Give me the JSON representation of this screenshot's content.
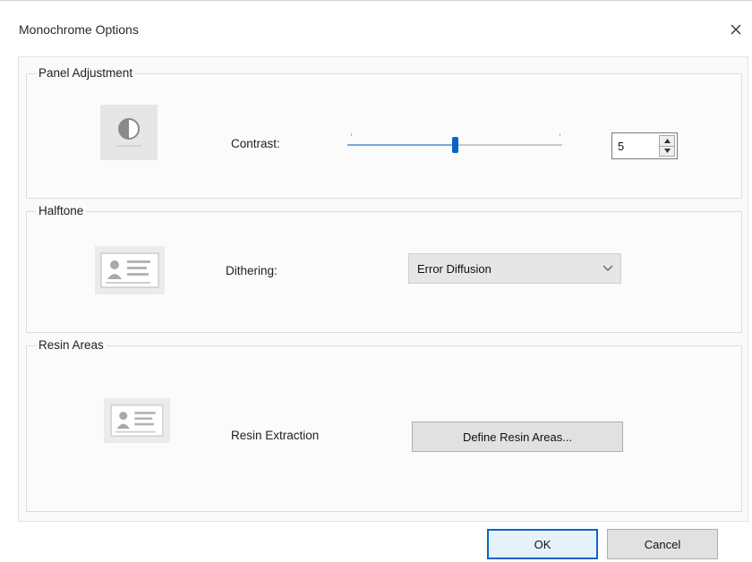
{
  "window": {
    "title": "Monochrome Options",
    "close_glyph": "✕"
  },
  "panel_adjustment": {
    "heading": "Panel Adjustment",
    "icon": "contrast-icon",
    "contrast_label": "Contrast:",
    "contrast_value": "5",
    "slider": {
      "min": 0,
      "max": 10,
      "value": 5
    }
  },
  "halftone": {
    "heading": "Halftone",
    "icon": "id-card-icon",
    "dithering_label": "Dithering:",
    "dithering_selected": "Error Diffusion"
  },
  "resin_areas": {
    "heading": "Resin Areas",
    "icon": "id-card-icon",
    "extraction_label": "Resin Extraction",
    "define_button": "Define Resin Areas..."
  },
  "footer": {
    "ok_label": "OK",
    "cancel_label": "Cancel"
  },
  "colors": {
    "accent": "#0a64c8",
    "group_border": "#dcdcdc",
    "button_face": "#e1e1e1"
  }
}
